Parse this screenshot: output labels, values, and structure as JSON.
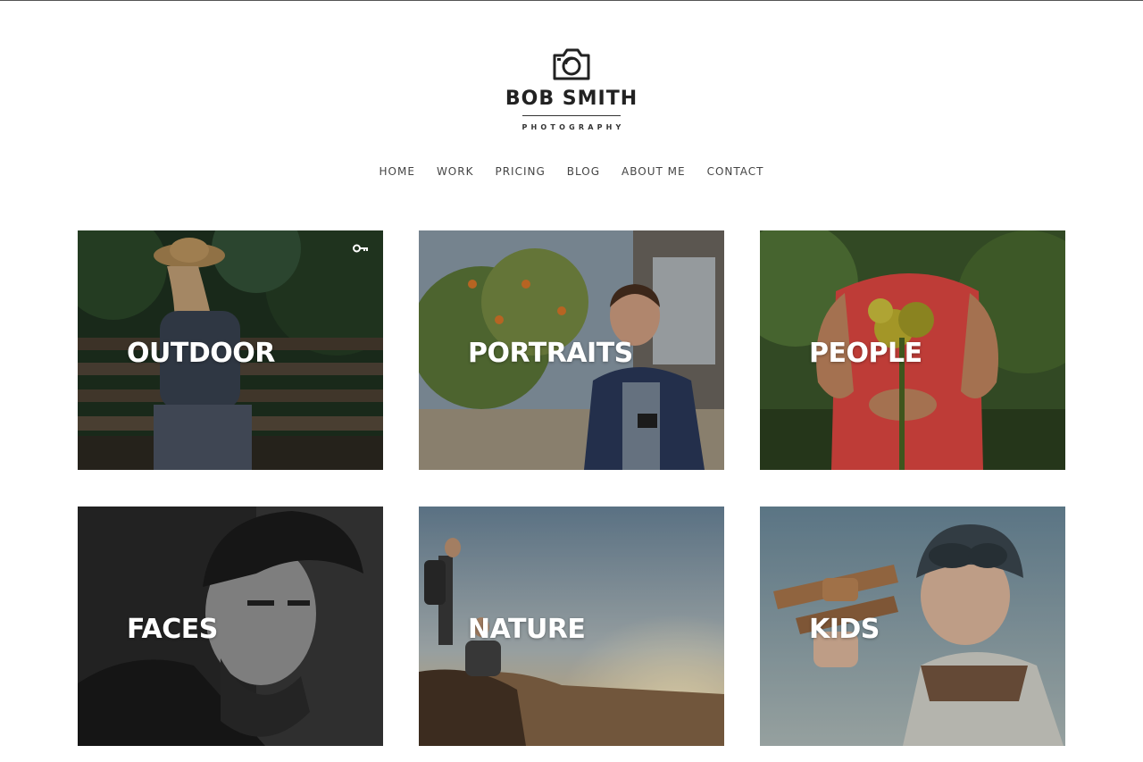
{
  "brand": {
    "name": "BOB SMITH",
    "tagline": "PHOTOGRAPHY",
    "logo_icon": "camera-icon"
  },
  "nav": {
    "items": [
      {
        "label": "HOME"
      },
      {
        "label": "WORK"
      },
      {
        "label": "PRICING"
      },
      {
        "label": "BLOG"
      },
      {
        "label": "ABOUT ME"
      },
      {
        "label": "CONTACT"
      }
    ]
  },
  "gallery": {
    "tiles": [
      {
        "label": "OUTDOOR",
        "locked": true,
        "lock_icon": "key-icon"
      },
      {
        "label": "PORTRAITS"
      },
      {
        "label": "PEOPLE"
      },
      {
        "label": "FACES"
      },
      {
        "label": "NATURE"
      },
      {
        "label": "KIDS"
      }
    ]
  },
  "colors": {
    "text_dark": "#222222",
    "nav_text": "#444444",
    "tile_label": "#ffffff"
  }
}
